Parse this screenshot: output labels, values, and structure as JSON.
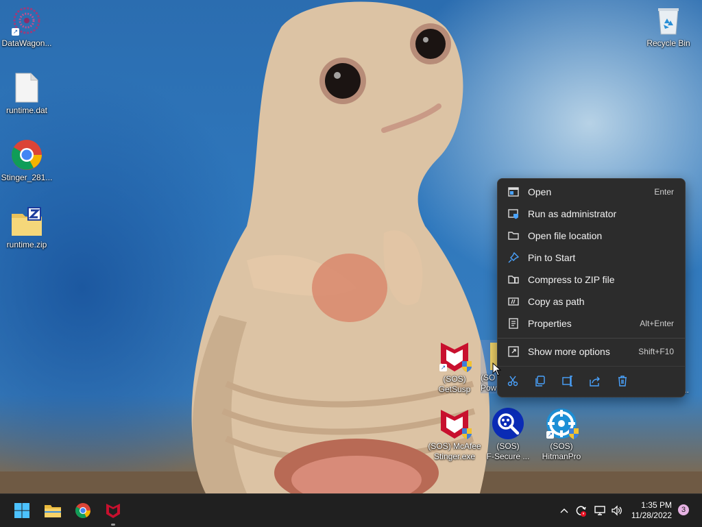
{
  "desktop_icons": [
    {
      "label": "DataWagon..."
    },
    {
      "label": "runtime.dat"
    },
    {
      "label": "Stinger_281..."
    },
    {
      "label": "runtime.zip"
    },
    {
      "label": "Recycle Bin"
    },
    {
      "label_line1": "(SOS)",
      "label_line2": "GetSusp"
    },
    {
      "label_line1": "(SO",
      "label_line2": "Pow"
    },
    {
      "label_line1": "(SOS) McAfee",
      "label_line2": "Stinger.exe"
    },
    {
      "label_line1": "(SOS)",
      "label_line2": "F-Secure ..."
    },
    {
      "label_line1": "(SOS)",
      "label_line2": "HitmanPro"
    }
  ],
  "hidden_icon_fragment": "...",
  "context_menu": {
    "items": [
      {
        "label": "Open",
        "shortcut": "Enter",
        "icon": "open-icon"
      },
      {
        "label": "Run as administrator",
        "shortcut": "",
        "icon": "run-as-admin-icon"
      },
      {
        "label": "Open file location",
        "shortcut": "",
        "icon": "folder-icon"
      },
      {
        "label": "Pin to Start",
        "shortcut": "",
        "icon": "pin-icon"
      },
      {
        "label": "Compress to ZIP file",
        "shortcut": "",
        "icon": "zip-icon"
      },
      {
        "label": "Copy as path",
        "shortcut": "",
        "icon": "copy-path-icon"
      },
      {
        "label": "Properties",
        "shortcut": "Alt+Enter",
        "icon": "properties-icon"
      },
      {
        "label": "Show more options",
        "shortcut": "Shift+F10",
        "icon": "more-options-icon"
      }
    ],
    "quick_actions": [
      "cut-icon",
      "copy-icon",
      "rename-icon",
      "share-icon",
      "delete-icon"
    ]
  },
  "taskbar": {
    "apps": [
      "start-icon",
      "file-explorer-icon",
      "chrome-icon",
      "mcafee-icon"
    ],
    "clock_time": "1:35 PM",
    "clock_date": "11/28/2022",
    "notification_count": "3"
  },
  "colors": {
    "menu_bg": "#2c2c2c",
    "taskbar_bg": "#202020",
    "accent_blue": "#4aa3ff",
    "mcafee_red": "#c8102e"
  }
}
